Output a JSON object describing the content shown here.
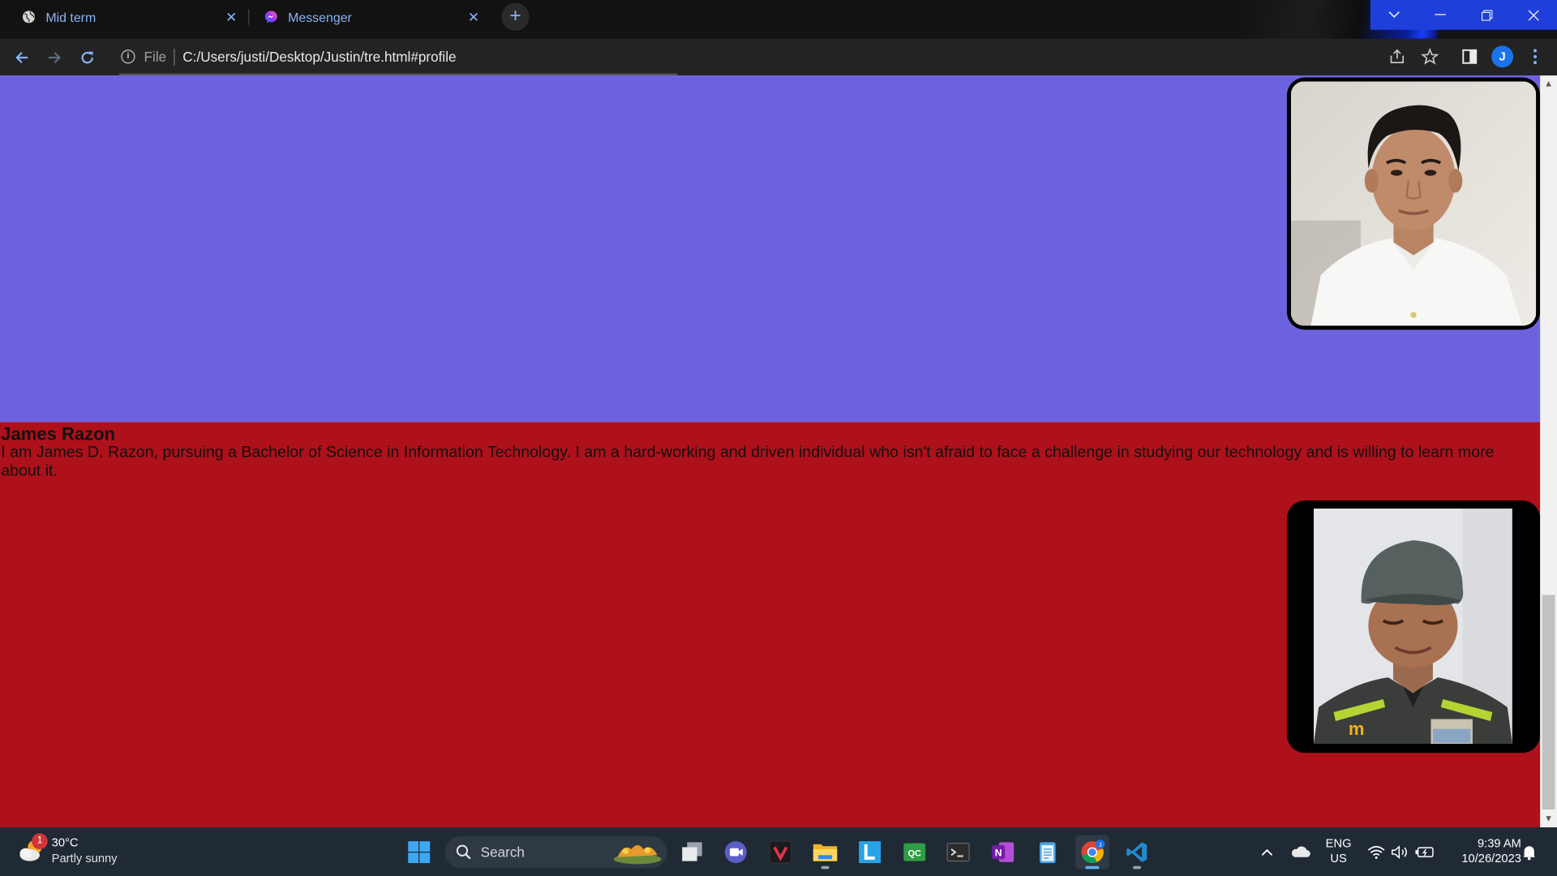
{
  "browser": {
    "tabs": [
      {
        "title": "Mid term",
        "icon": "globe-icon",
        "active": false
      },
      {
        "title": "Messenger",
        "icon": "messenger-icon",
        "active": true
      }
    ],
    "omnibox": {
      "scheme_label": "File",
      "url": "C:/Users/justi/Desktop/Justin/tre.html#profile"
    },
    "profile_initial": "J",
    "window_buttons": [
      "tab-search",
      "minimize",
      "restore",
      "close"
    ]
  },
  "page": {
    "sections": [
      {
        "background": "#6c62de",
        "name": "",
        "bio": "",
        "photo": "smiling young man in white polo shirt"
      },
      {
        "background": "#ae111a",
        "name": "James Razon",
        "bio": "I am James D. Razon, pursuing a Bachelor of Science in Information Technology. I am a hard-working and driven individual who isn't afraid to face a challenge in studying our technology and is willing to learn more about it.",
        "photo": "young man in gray cap and work uniform"
      }
    ],
    "scroll_position_fraction": 0.79
  },
  "taskbar": {
    "weather": {
      "temp": "30°C",
      "condition": "Partly sunny",
      "badge": "1"
    },
    "search_placeholder": "Search",
    "apps": [
      "start",
      "search",
      "task-view",
      "meet",
      "vsco",
      "file-explorer",
      "lucid",
      "qc",
      "terminal",
      "onenote",
      "notepad",
      "chrome",
      "vscode"
    ],
    "tray": {
      "lang_line1": "ENG",
      "lang_line2": "US",
      "time": "9:39 AM",
      "date": "10/26/2023"
    }
  },
  "colors": {
    "accent_blue": "#8ab4f8",
    "section_purple": "#6c62de",
    "section_red": "#ae111a",
    "taskbar": "#202a35"
  }
}
